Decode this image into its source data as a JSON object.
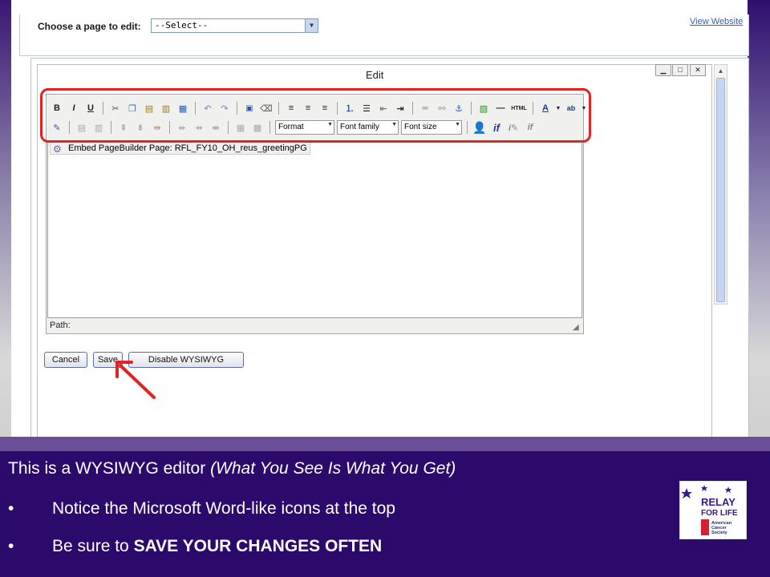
{
  "header": {
    "choose_label": "Choose a page to edit:",
    "page_select_value": "--Select--",
    "view_website": "View Website"
  },
  "edit_window": {
    "title": "Edit",
    "window_controls": [
      "minimize",
      "maximize",
      "close"
    ]
  },
  "toolbar": {
    "row1": [
      "bold-icon",
      "italic-icon",
      "underline-icon",
      "cut-icon",
      "copy-icon",
      "paste-icon",
      "paste-text-icon",
      "paste-word-icon",
      "undo-icon",
      "redo-icon",
      "select-all-icon",
      "clean-up-icon",
      "align-left-icon",
      "align-center-icon",
      "align-right-icon",
      "ordered-list-icon",
      "unordered-list-icon",
      "outdent-icon",
      "indent-icon",
      "link-icon",
      "unlink-icon",
      "anchor-icon",
      "image-icon",
      "horizontal-rule-icon",
      "html-source-icon",
      "text-color-icon",
      "highlight-color-icon"
    ],
    "html_label": "HTML",
    "format_label": "Format",
    "font_family_label": "Font family",
    "font_size_label": "Font size",
    "if_label": "if"
  },
  "editor": {
    "embed_text": "Embed PageBuilder Page: RFL_FY10_OH_reus_greetingPG",
    "path_label": "Path:"
  },
  "buttons": {
    "cancel": "Cancel",
    "save": "Save",
    "disable_wysiwyg": "Disable WYSIWYG"
  },
  "caption": {
    "line1_plain": "This is a WYSIWYG editor ",
    "line1_italic": "(What You See Is What You Get)",
    "bullet1": "Notice the Microsoft Word-like icons at the top",
    "bullet2_plain": "Be sure to ",
    "bullet2_bold": "SAVE YOUR CHANGES OFTEN",
    "bullet_symbol": "•"
  },
  "logo": {
    "line1": "RELAY",
    "line2": "FOR LIFE",
    "line3": "American",
    "line4": "Cancer",
    "line5": "Society"
  },
  "colors": {
    "caption_bg": "#2c0a6b",
    "highlight_red": "#e32222",
    "link_blue": "#3b5fa8"
  }
}
